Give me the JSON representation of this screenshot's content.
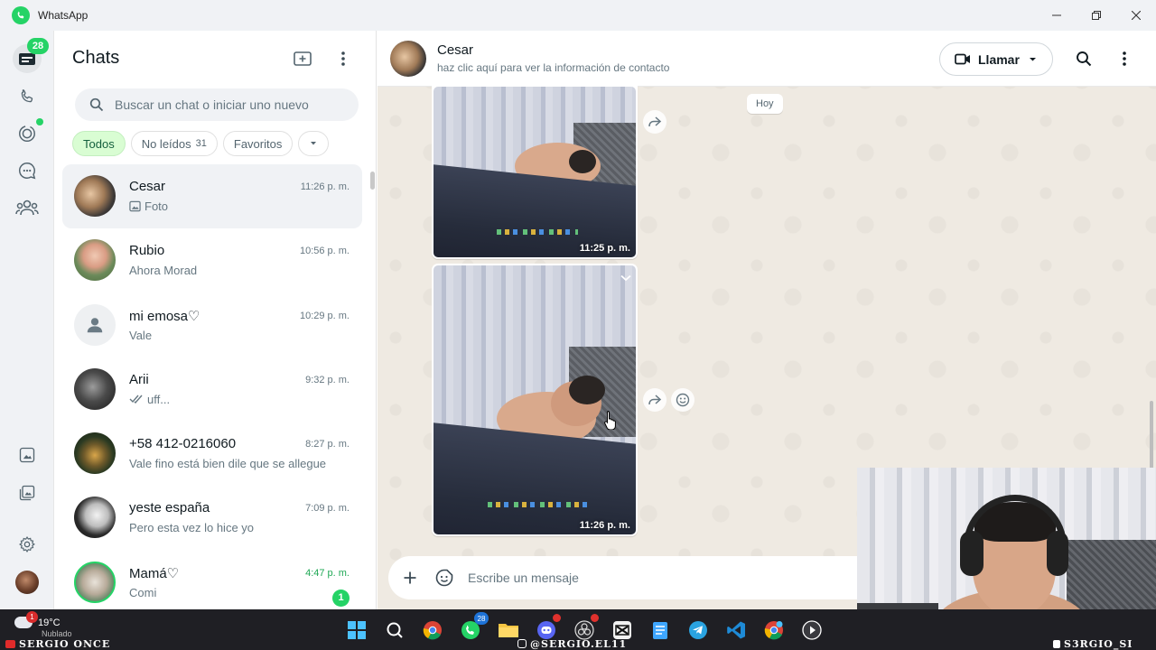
{
  "window": {
    "title": "WhatsApp",
    "controls": [
      "minimize",
      "maximize",
      "close"
    ]
  },
  "rail": {
    "chats_badge": "28"
  },
  "chats_panel": {
    "title": "Chats",
    "search_placeholder": "Buscar un chat o iniciar uno nuevo",
    "filters": [
      {
        "label": "Todos",
        "count": "",
        "active": true
      },
      {
        "label": "No leídos",
        "count": "31",
        "active": false
      },
      {
        "label": "Favoritos",
        "count": "",
        "active": false
      }
    ],
    "chats": [
      {
        "name": "Cesar",
        "time": "11:26 p. m.",
        "preview": "Foto",
        "preview_icon": "photo-icon",
        "selected": true
      },
      {
        "name": "Rubio",
        "time": "10:56 p. m.",
        "preview": "Ahora Morad"
      },
      {
        "name": "mi emosa♡",
        "time": "10:29 p. m.",
        "preview": "Vale",
        "default_avatar": true
      },
      {
        "name": "Arii",
        "time": "9:32 p. m.",
        "preview": "uff...",
        "preview_icon": "double-check-icon"
      },
      {
        "name": "+58 412-0216060",
        "time": "8:27 p. m.",
        "preview": "Vale fino está bien dile que se allegue"
      },
      {
        "name": "yeste españa",
        "time": "7:09 p. m.",
        "preview": "Pero esta vez lo hice yo"
      },
      {
        "name": "Mamá♡",
        "time": "4:47 p. m.",
        "preview": "Comi",
        "unread": "1",
        "time_green": true
      }
    ]
  },
  "conversation": {
    "contact_name": "Cesar",
    "contact_sub": "haz clic aquí para ver la información de contacto",
    "call_label": "Llamar",
    "day_label": "Hoy",
    "messages": [
      {
        "type": "photo",
        "time": "11:25 p. m."
      },
      {
        "type": "photo",
        "time": "11:26 p. m."
      }
    ],
    "composer_placeholder": "Escribe un mensaje"
  },
  "taskbar": {
    "weather_temp": "19°C",
    "weather_cond": "Nublado",
    "weather_badge": "1",
    "whatsapp_badge": "28"
  },
  "watermarks": {
    "left": "SERGIO ONCE",
    "center": "@SERGIO.EL11",
    "right": "S3RGIO_SI"
  },
  "colors": {
    "accent": "#25d366",
    "chat_bg": "#efeae2",
    "active_chip": "#d9fdd3"
  }
}
